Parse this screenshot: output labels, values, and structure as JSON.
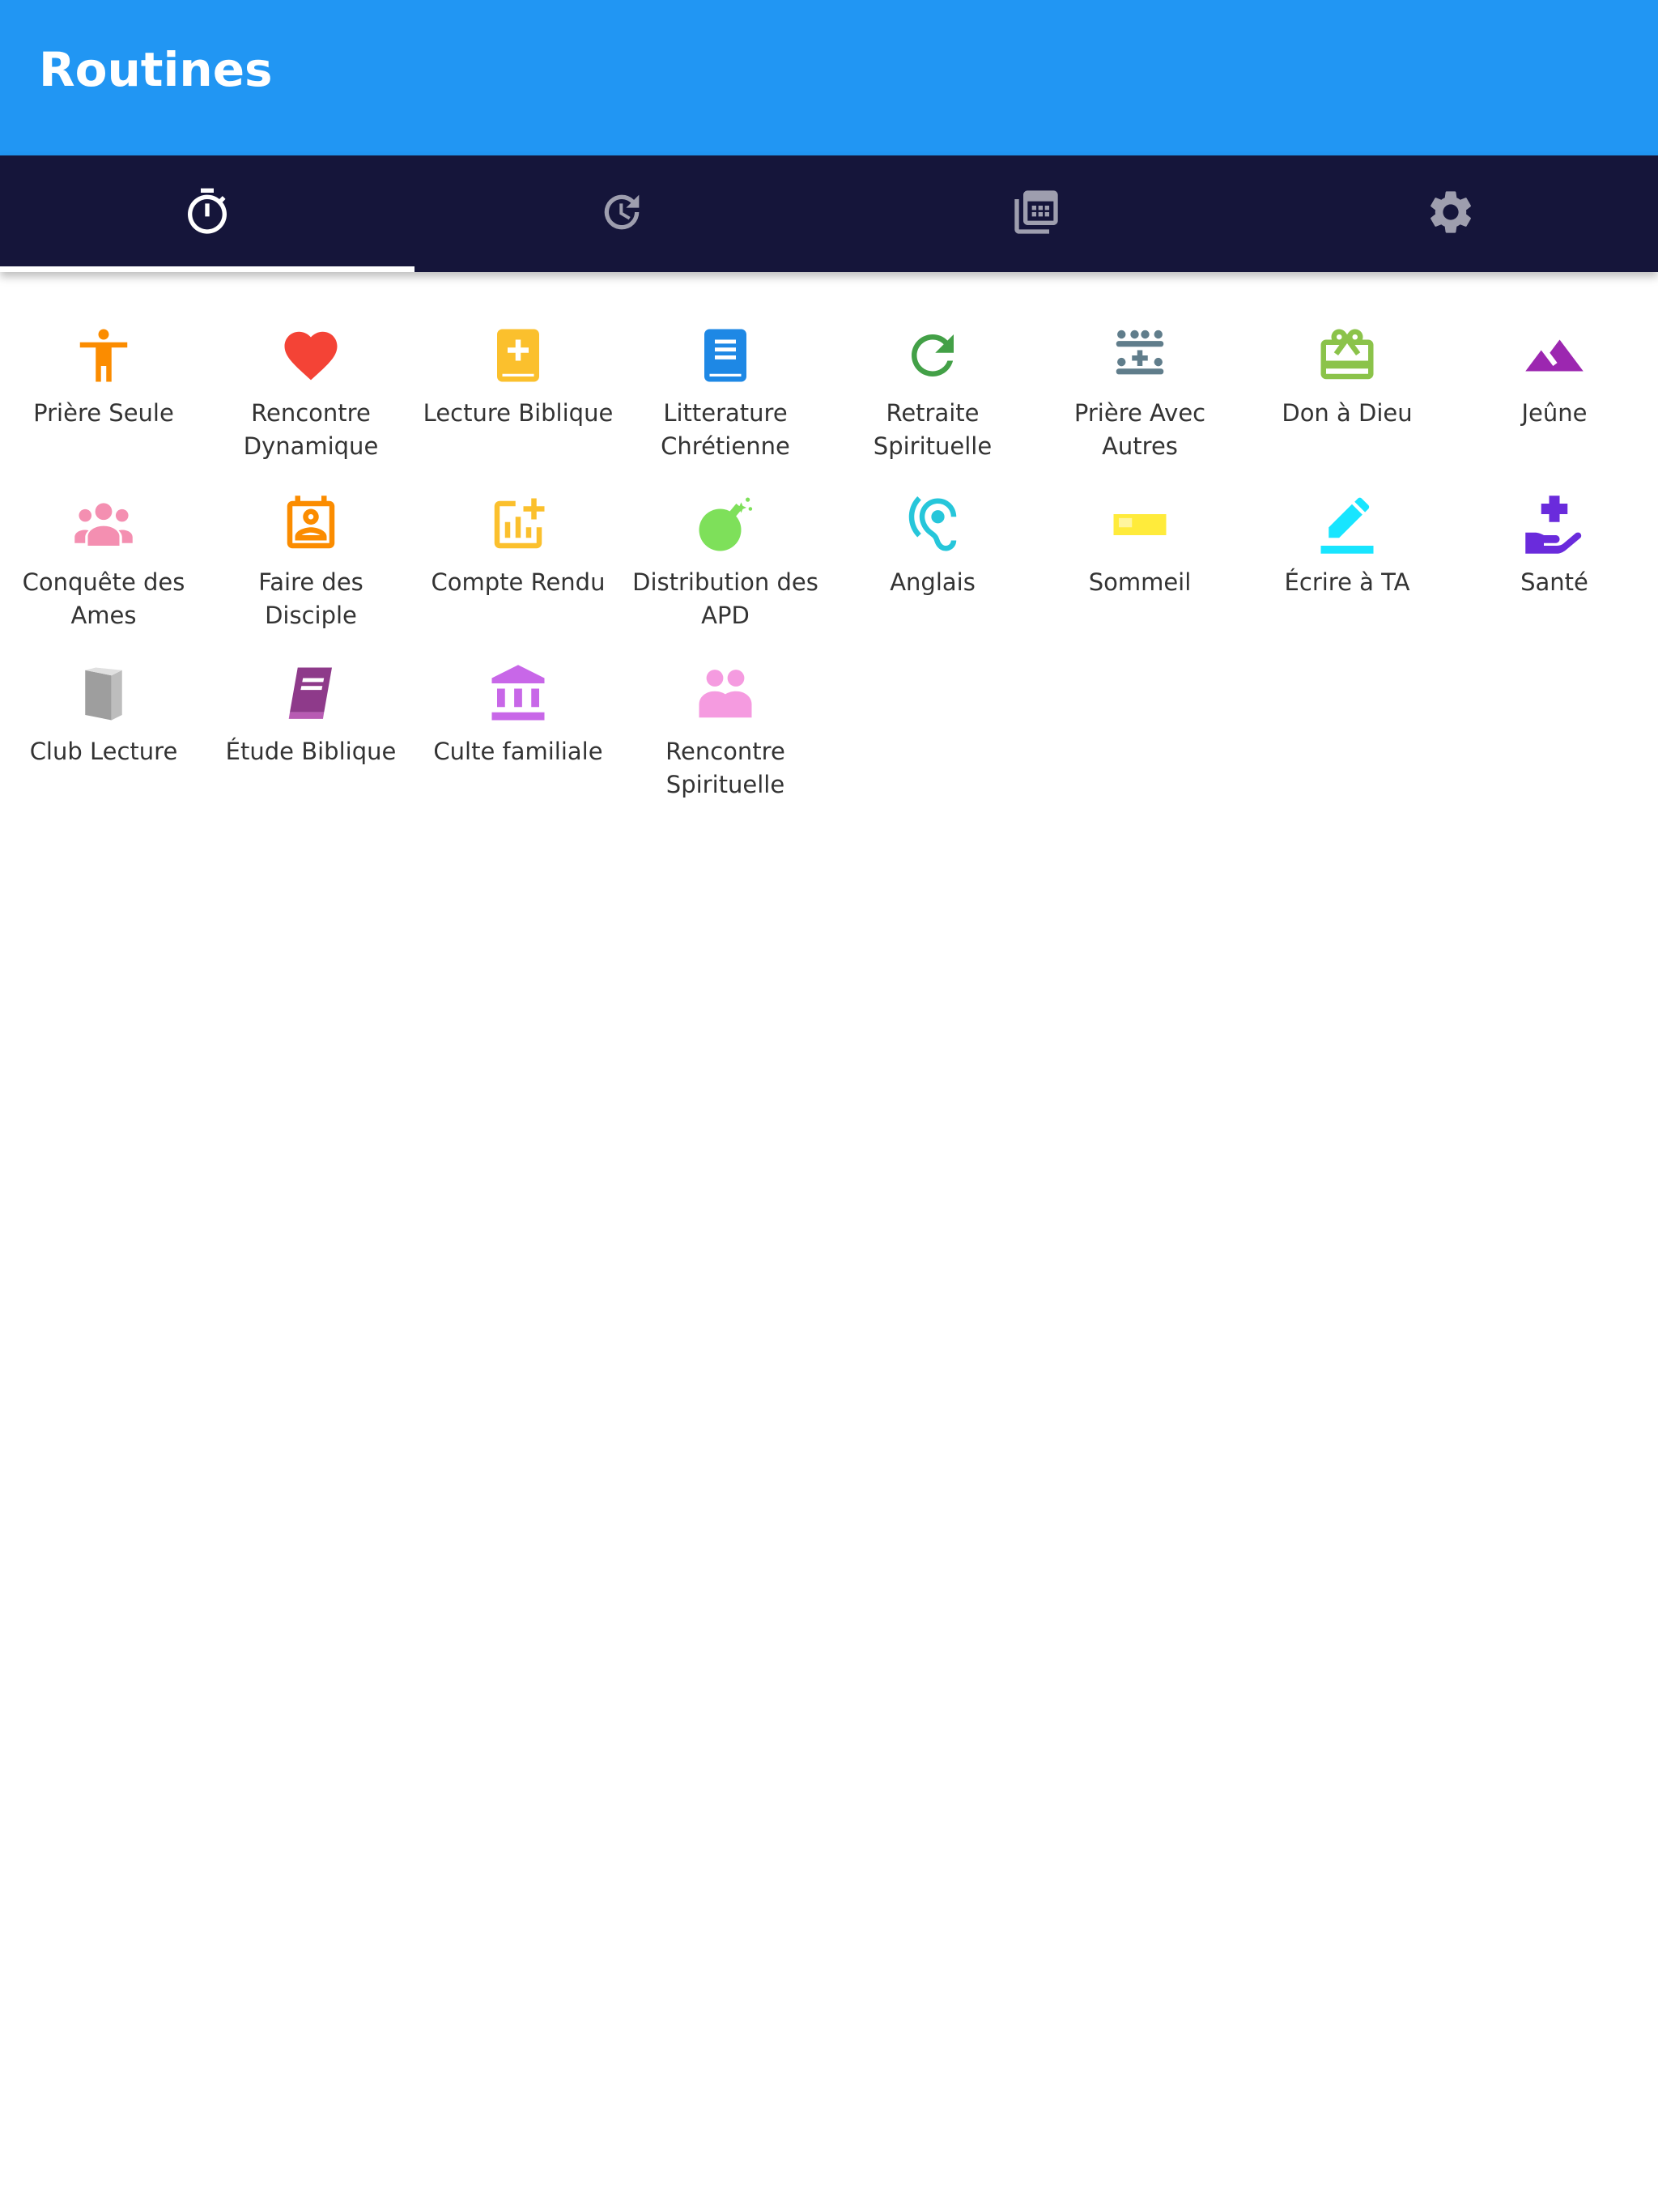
{
  "header": {
    "title": "Routines",
    "color": "#2196f3"
  },
  "tabs": [
    {
      "icon": "timer-icon",
      "active": true
    },
    {
      "icon": "history-icon",
      "active": false
    },
    {
      "icon": "calendar-grid-icon",
      "active": false
    },
    {
      "icon": "gear-icon",
      "active": false
    }
  ],
  "tab_bar_color": "#15153a",
  "routines": [
    {
      "label": "Prière Seule",
      "icon": "person-standing-icon",
      "color": "#fb8c00"
    },
    {
      "label": "Rencontre Dynamique",
      "icon": "heart-icon",
      "color": "#f44336"
    },
    {
      "label": "Lecture Biblique",
      "icon": "bible-book-icon",
      "color": "#fbc02d"
    },
    {
      "label": "Litterature Chrétienne",
      "icon": "book-icon",
      "color": "#1e88e5"
    },
    {
      "label": "Retraite Spirituelle",
      "icon": "refresh-icon",
      "color": "#43a047"
    },
    {
      "label": "Prière Avec Autres",
      "icon": "group-prayer-icon",
      "color": "#607d8b"
    },
    {
      "label": "Don à Dieu",
      "icon": "gift-card-icon",
      "color": "#8bc34a"
    },
    {
      "label": "Jeûne",
      "icon": "mountain-icon",
      "color": "#9c27b0"
    },
    {
      "label": "Conquête des Ames",
      "icon": "people-group-icon",
      "color": "#f48fb1"
    },
    {
      "label": "Faire des Disciple",
      "icon": "contact-card-icon",
      "color": "#fb8c00"
    },
    {
      "label": "Compte Rendu",
      "icon": "add-chart-icon",
      "color": "#fbc02d"
    },
    {
      "label": "Distribution des APD",
      "icon": "bomb-icon",
      "color": "#7ee05a"
    },
    {
      "label": "Anglais",
      "icon": "hearing-icon",
      "color": "#26c6da"
    },
    {
      "label": "Sommeil",
      "icon": "bed-icon",
      "color": "#ffeb3b"
    },
    {
      "label": "Écrire à TA",
      "icon": "pencil-icon",
      "color": "#18e5ff"
    },
    {
      "label": "Santé",
      "icon": "health-hand-icon",
      "color": "#6a2bdc"
    },
    {
      "label": "Club Lecture",
      "icon": "closed-book-icon",
      "color": "#9e9e9e"
    },
    {
      "label": "Étude Biblique",
      "icon": "study-book-icon",
      "color": "#8e3a8a"
    },
    {
      "label": "Culte familiale",
      "icon": "temple-icon",
      "color": "#c867e8"
    },
    {
      "label": "Rencontre Spirituelle",
      "icon": "two-people-icon",
      "color": "#f59be0"
    }
  ]
}
